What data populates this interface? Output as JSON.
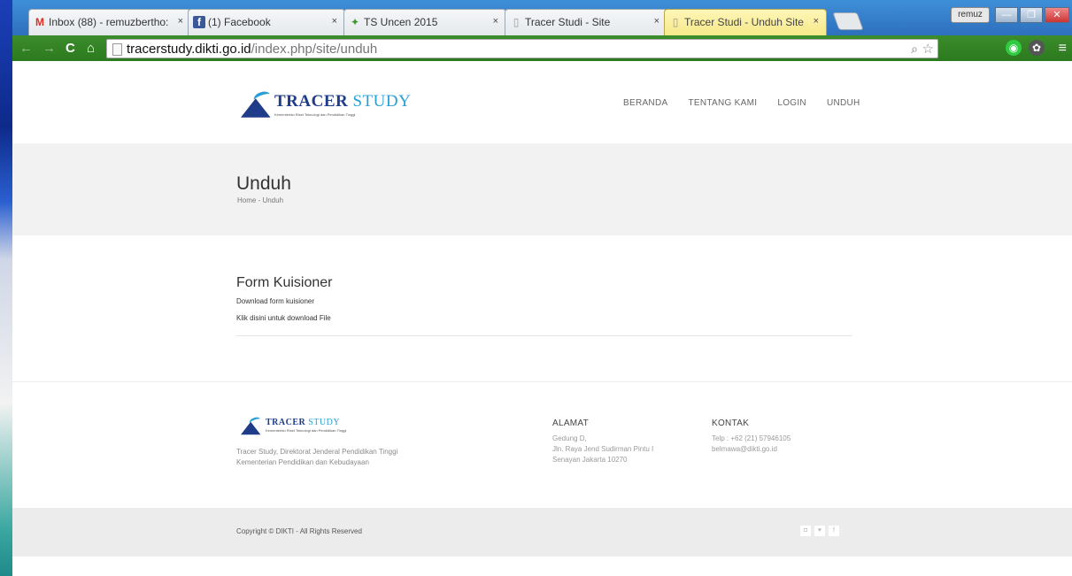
{
  "browser": {
    "tabs": [
      {
        "icon": "gmail-icon",
        "glyph": "M",
        "label": "Inbox (88) - remuzbertho:"
      },
      {
        "icon": "facebook-icon",
        "glyph": "f",
        "label": "(1) Facebook"
      },
      {
        "icon": "tree-icon",
        "glyph": "✦",
        "label": "TS Uncen 2015"
      },
      {
        "icon": "page-icon",
        "glyph": "▯",
        "label": "Tracer Studi - Site"
      },
      {
        "icon": "page-icon",
        "glyph": "▯",
        "label": "Tracer Studi - Unduh Site"
      }
    ],
    "close_glyph": "×",
    "window_user": "remuz",
    "url_host": "tracerstudy.dikti.go.id",
    "url_path": "/index.php/site/unduh"
  },
  "site": {
    "logo": {
      "text1": "TRACER",
      "text2": "STUDY",
      "sub": "Kementerian Riset Teknologi dan Pendidikan Tinggi"
    },
    "nav": [
      "BERANDA",
      "TENTANG KAMI",
      "LOGIN",
      "UNDUH"
    ],
    "page_title": "Unduh",
    "breadcrumb": "Home - Unduh",
    "section": {
      "title": "Form Kuisioner",
      "desc": "Download form kuisioner",
      "link": "Klik disini untuk download File"
    },
    "footer": {
      "desc_line1": "Tracer Study, Direktorat Jenderal Pendidikan Tinggi",
      "desc_line2": "Kementerian Pendidikan dan Kebudayaan",
      "alamat_title": "ALAMAT",
      "alamat_lines": [
        "Gedung D,",
        "Jln. Raya Jend Sudirman Pintu I",
        "Senayan Jakarta 10270"
      ],
      "kontak_title": "KONTAK",
      "kontak_lines": [
        "Telp : +62 (21) 57946105",
        "belmawa@dikti.go.id"
      ]
    },
    "copyright": "Copyright © DIKTI - All Rights Reserved",
    "socials": [
      "rss-icon",
      "twitter-icon",
      "facebook-icon"
    ]
  },
  "colors": {
    "brand_blue": "#1f3c88",
    "brand_light": "#2a9fd6",
    "tab_active": "#f5e88a",
    "toolbar": "#2c7a1f"
  }
}
